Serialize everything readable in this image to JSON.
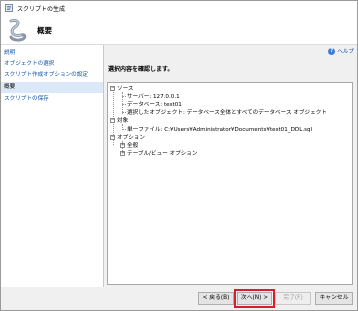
{
  "window": {
    "title": "スクリプトの生成"
  },
  "header": {
    "heading": "概要"
  },
  "sidebar": {
    "items": [
      {
        "label": "説明",
        "active": false
      },
      {
        "label": "オブジェクトの選択",
        "active": false
      },
      {
        "label": "スクリプト作成オプションの設定",
        "active": false
      },
      {
        "label": "概要",
        "active": true
      },
      {
        "label": "スクリプトの保存",
        "active": false
      }
    ]
  },
  "main": {
    "help_label": "ヘルプ",
    "confirm_text": "選択内容を確認します。",
    "tree": {
      "source": "ソース",
      "server": "サーバー: 127.0.0.1",
      "database": "データベース: test01",
      "selected_objects": "選択したオブジェクト: データベース全体とすべてのデータベース オブジェクト",
      "target": "対象",
      "single_file": "単一ファイル: C:¥Users¥Administrator¥Documents¥test01_DDL.sql",
      "options": "オプション",
      "general": "全般",
      "table_view_options": "テーブル/ビュー オプション"
    }
  },
  "footer": {
    "back": "< 戻る(B)",
    "next": "次へ(N) >",
    "finish": "完了(F)",
    "cancel": "キャンセル"
  },
  "colors": {
    "link": "#0b4fa8",
    "selected_bg": "#dbe8f8",
    "highlight_border": "#d4202c"
  }
}
